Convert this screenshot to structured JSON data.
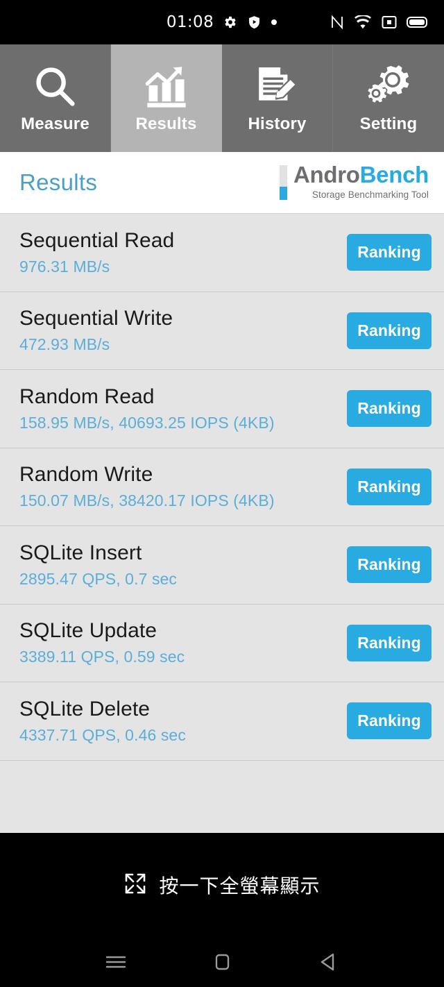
{
  "statusbar": {
    "time": "01:08",
    "left_icons": [
      "gear-icon",
      "shield-play-icon",
      "dot-icon"
    ],
    "right_icons": [
      "nfc-icon",
      "wifi-icon",
      "screen-record-icon",
      "battery-icon"
    ]
  },
  "tabs": [
    {
      "label": "Measure",
      "icon": "magnifier-icon",
      "active": false
    },
    {
      "label": "Results",
      "icon": "bar-chart-trend-icon",
      "active": true
    },
    {
      "label": "History",
      "icon": "document-pencil-icon",
      "active": false
    },
    {
      "label": "Setting",
      "icon": "gears-icon",
      "active": false
    }
  ],
  "header": {
    "title": "Results",
    "logo_primary": "Andro",
    "logo_secondary": "Bench",
    "logo_subtitle": "Storage Benchmarking Tool"
  },
  "results": [
    {
      "title": "Sequential Read",
      "value": "976.31 MB/s",
      "button": "Ranking"
    },
    {
      "title": "Sequential Write",
      "value": "472.93 MB/s",
      "button": "Ranking"
    },
    {
      "title": "Random Read",
      "value": "158.95 MB/s, 40693.25 IOPS (4KB)",
      "button": "Ranking"
    },
    {
      "title": "Random Write",
      "value": "150.07 MB/s, 38420.17 IOPS (4KB)",
      "button": "Ranking"
    },
    {
      "title": "SQLite Insert",
      "value": "2895.47 QPS, 0.7 sec",
      "button": "Ranking"
    },
    {
      "title": "SQLite Update",
      "value": "3389.11 QPS, 0.59 sec",
      "button": "Ranking"
    },
    {
      "title": "SQLite Delete",
      "value": "4337.71 QPS, 0.46 sec",
      "button": "Ranking"
    }
  ],
  "hintbar": {
    "text": "按一下全螢幕顯示",
    "icon": "fullscreen-expand-icon"
  },
  "navbar": {
    "recents": "menu-icon",
    "home": "home-square-icon",
    "back": "back-triangle-icon"
  },
  "colors": {
    "accent_blue": "#29abe2",
    "value_blue": "#5aaed8",
    "title_blue": "#4b9ec6",
    "tab_inactive": "#6e6e6e",
    "tab_active": "#b4b4b4",
    "list_bg": "#e4e4e4",
    "logo_gray": "#6d6e71"
  }
}
